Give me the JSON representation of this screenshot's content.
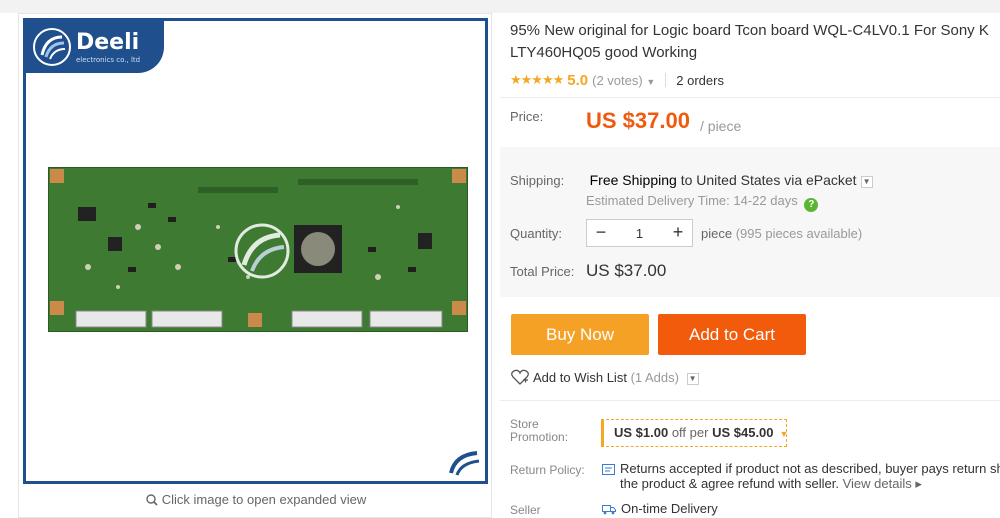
{
  "brand": {
    "name": "Deeli",
    "tagline": "electronics co., ltd"
  },
  "gallery": {
    "caption": "Click image to open expanded view"
  },
  "product": {
    "title_line1": "95% New original for Logic board Tcon board WQL-C4LV0.1 For Sony K",
    "title_line2": "LTY460HQ05 good Working",
    "rating": {
      "stars": "★★★★★",
      "value": "5.0",
      "votes": "(2 votes)",
      "votes_caret": "▼",
      "orders": "2 orders"
    }
  },
  "price": {
    "label": "Price:",
    "amount": "US $37.00",
    "unit": "/ piece"
  },
  "shipping": {
    "label": "Shipping:",
    "free": "Free Shipping",
    "to": "to",
    "dest": "United States via ePacket",
    "dropdown": "▼",
    "est_label": "Estimated Delivery Time:",
    "est_days": "14-22 days",
    "help": "?"
  },
  "quantity": {
    "label": "Quantity:",
    "minus": "−",
    "value": "1",
    "plus": "+",
    "avail_prefix": "piece",
    "avail": "(995 pieces available)"
  },
  "total": {
    "label": "Total Price:",
    "value": "US $37.00"
  },
  "actions": {
    "buy_now": "Buy Now",
    "add_to_cart": "Add to Cart"
  },
  "wishlist": {
    "label": "Add to Wish List",
    "count": "(1 Adds)",
    "caret": "▼"
  },
  "promotion": {
    "label": "Store Promotion:",
    "amount": "US $1.00",
    "off_per": "off per",
    "threshold": "US $45.00",
    "caret": "▼"
  },
  "return_policy": {
    "label": "Return Policy:",
    "line1": "Returns accepted if product not as described, buyer pays return sh",
    "line2": "the product & agree refund with seller.",
    "link": "View details ▸"
  },
  "seller": {
    "label": "Seller",
    "value": "On-time Delivery"
  },
  "colors": {
    "brand_blue": "#1f4f8c",
    "accent_orange": "#f05a0e",
    "buy_now": "#f5a126",
    "add_to_cart": "#f25a0c",
    "star": "#f5a623",
    "help_green": "#5cb531"
  }
}
